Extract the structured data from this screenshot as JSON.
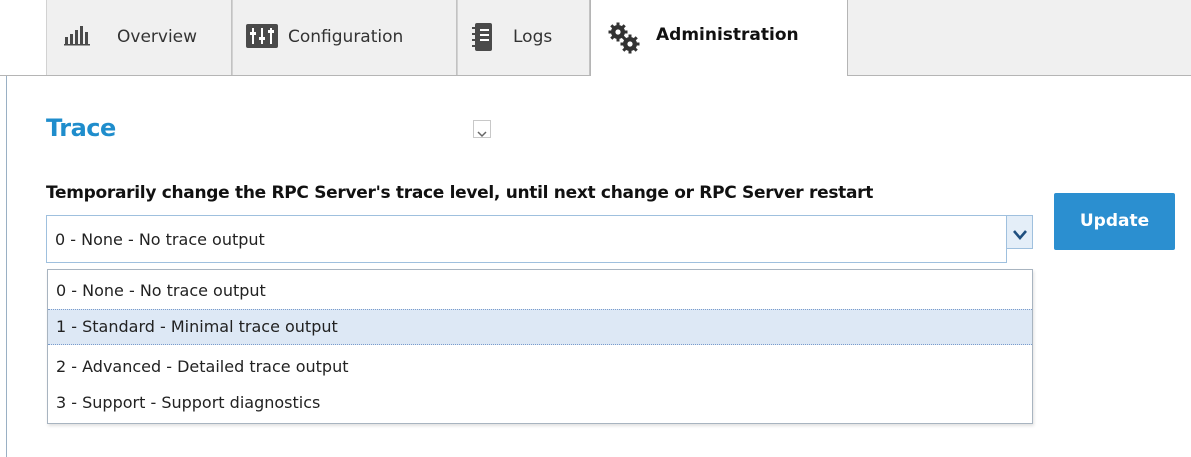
{
  "tabs": [
    {
      "label": "Overview",
      "icon": "bar-chart-icon"
    },
    {
      "label": "Configuration",
      "icon": "sliders-icon"
    },
    {
      "label": "Logs",
      "icon": "notebook-icon"
    },
    {
      "label": "Administration",
      "icon": "gears-icon",
      "active": true
    }
  ],
  "section": {
    "title": "Trace",
    "collapse_icon": "chevron-down-icon"
  },
  "trace_level": {
    "label": "Temporarily change the RPC Server's trace level, until next change or RPC Server restart",
    "value": "0 - None - No trace output",
    "options": [
      "0 - None - No trace output",
      "1 - Standard - Minimal trace output",
      "2 - Advanced - Detailed trace output",
      "3 - Support - Support diagnostics"
    ],
    "highlighted_option": "1 - Standard - Minimal trace output"
  },
  "update_button": {
    "label": "Update"
  },
  "colors": {
    "title_blue": "#1f8dcc",
    "button_blue": "#2b8fd0",
    "highlight": "#dde8f5"
  }
}
